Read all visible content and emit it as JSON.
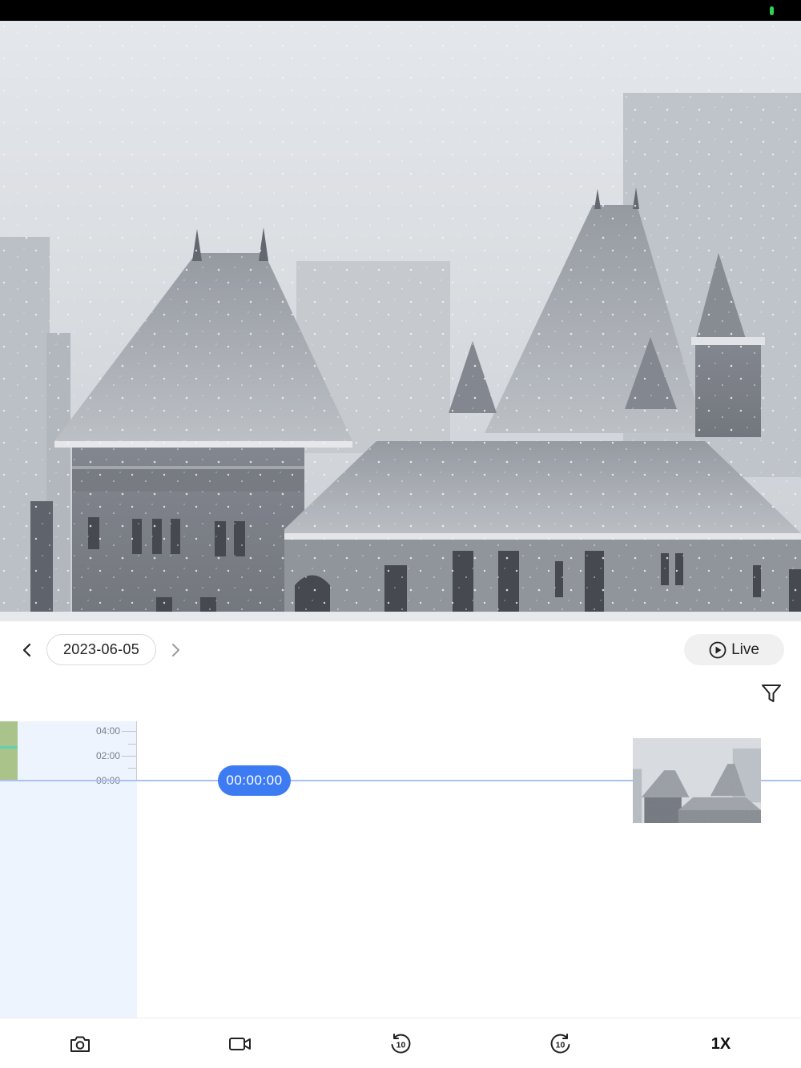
{
  "date_nav": {
    "date": "2023-06-05",
    "prev_icon": "chevron-left-icon",
    "next_icon": "chevron-right-icon"
  },
  "live": {
    "label": "Live",
    "icon": "play-circle-icon"
  },
  "filter": {
    "icon": "filter-icon"
  },
  "timeline": {
    "ticks": [
      "04:00",
      "02:00",
      "00:00"
    ],
    "current_time": "00:00:00"
  },
  "toolbar": {
    "snapshot_icon": "camera-icon",
    "record_icon": "video-camera-icon",
    "rewind_icon": "rewind-10-icon",
    "forward_icon": "forward-10-icon",
    "speed_label": "1X"
  },
  "colors": {
    "accent": "#3d7bf2",
    "recording": "#aac38a",
    "timeline_bg": "#eef4fd"
  }
}
